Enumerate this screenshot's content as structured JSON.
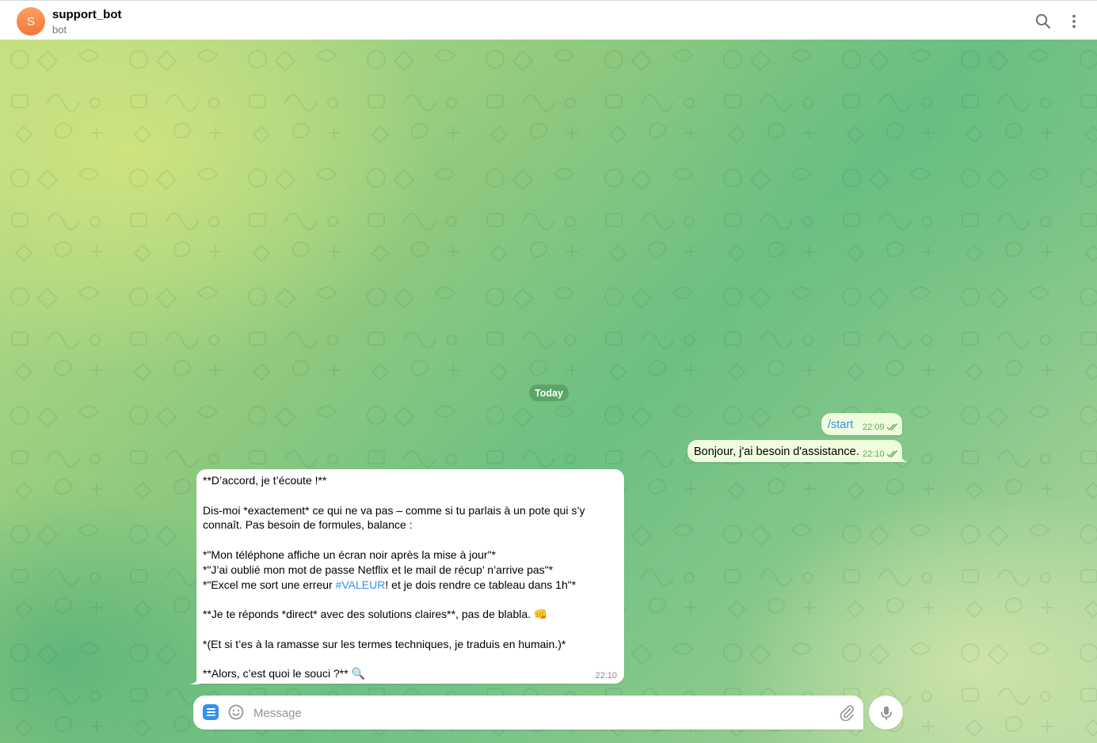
{
  "header": {
    "avatar_letter": "S",
    "title": "support_bot",
    "subtitle": "bot",
    "search_icon": "search-icon",
    "more_icon": "more-vertical-icon"
  },
  "date_separator": "Today",
  "messages": [
    {
      "direction": "out",
      "text": "/start",
      "time": "22:09",
      "status": "read"
    },
    {
      "direction": "out",
      "text": "Bonjour, j'ai besoin d'assistance.",
      "time": "22:10",
      "status": "read"
    },
    {
      "direction": "in",
      "lines": [
        "**D’accord, je t’écoute !**",
        "",
        "Dis-moi *exactement* ce qui ne va pas – comme si tu parlais à un pote qui s’y",
        "connaît. Pas besoin de formules, balance :",
        "",
        "*\"Mon téléphone affiche un écran noir après la mise à jour\"*",
        "*\"J’ai oublié mon mot de passe Netflix et le mail de récup’ n’arrive pas\"*",
        "*\"Excel me sort une erreur ",
        "#VALEUR",
        "! et je dois rendre ce tableau dans 1h\"*",
        "",
        "**Je te réponds *direct* avec des solutions claires**, pas de blabla. 👊",
        "",
        "*(Et si t’es à la ramasse sur les termes techniques, je traduis en humain.)*",
        "",
        "**Alors, c’est quoi le souci ?** 🔍"
      ],
      "time": "22:10"
    }
  ],
  "composer": {
    "placeholder": "Message",
    "menu_icon": "bot-menu-icon",
    "emoji_icon": "emoji-icon",
    "attach_icon": "paperclip-icon",
    "mic_icon": "microphone-icon"
  },
  "colors": {
    "accent": "#3390ec",
    "outgoing_bubble": "#effdde",
    "read_check": "#5fa955",
    "avatar": "#f58a4b"
  }
}
